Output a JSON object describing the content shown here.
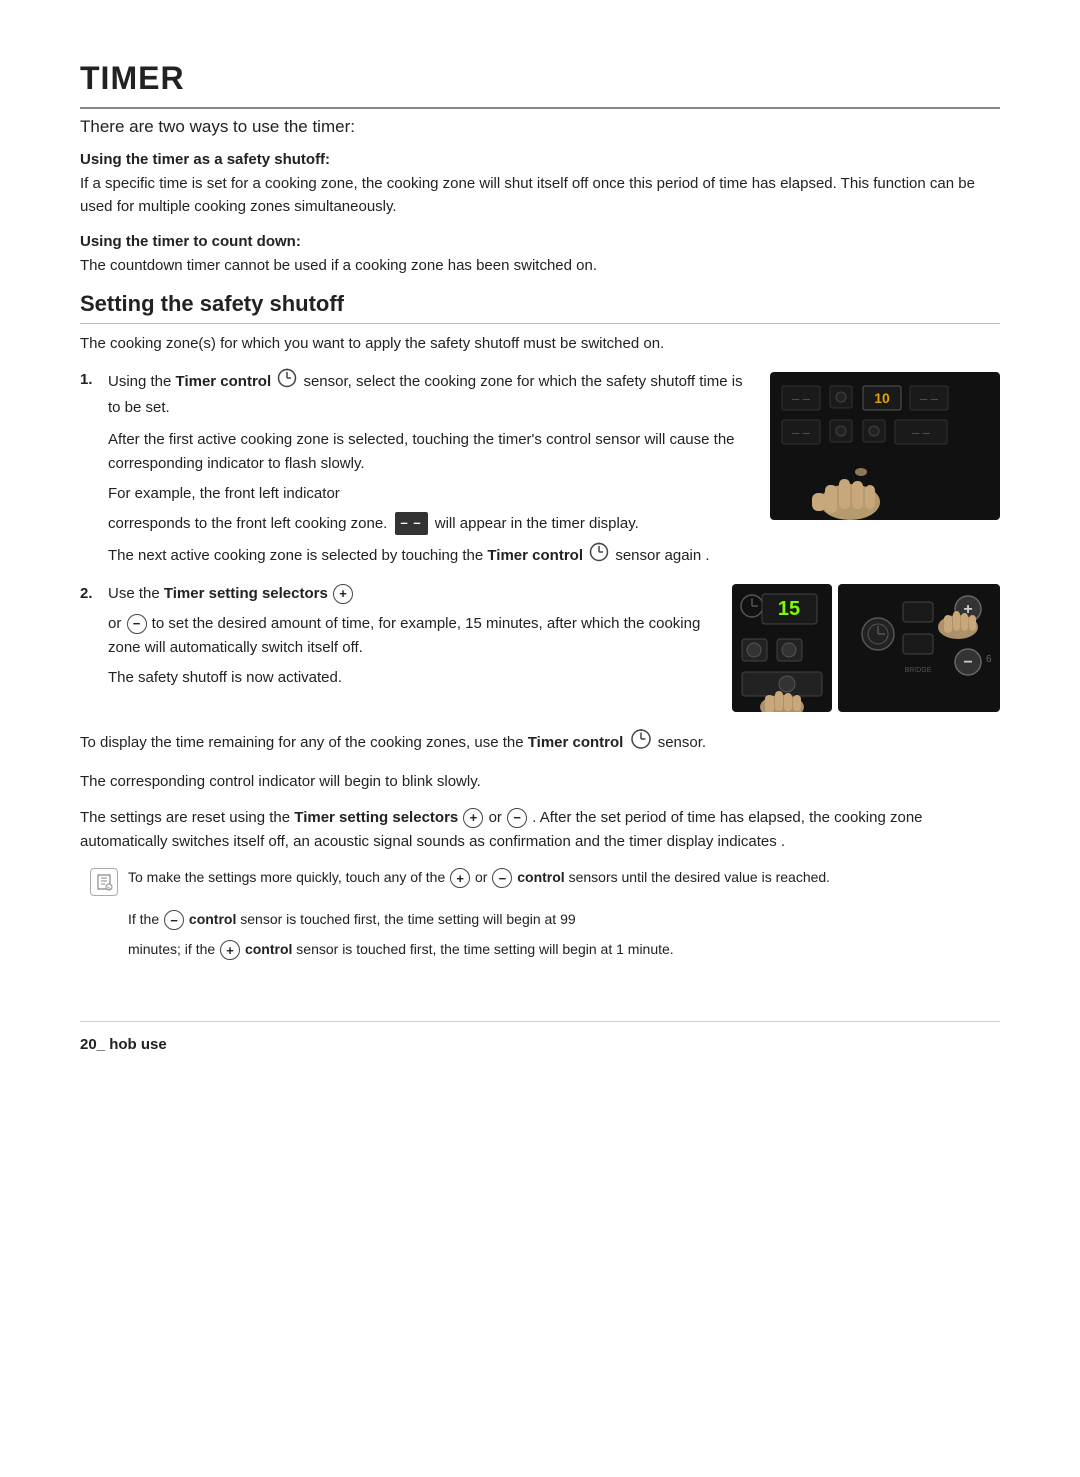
{
  "page": {
    "title": "TIMER",
    "subtitle": "There are two ways to use the timer:",
    "section1": {
      "label": "Using the timer as a safety shutoff:",
      "text": "If a specific time is set for a cooking zone, the cooking zone will shut itself off once this period of time has elapsed. This function can be used for multiple cooking zones simultaneously."
    },
    "section2": {
      "label": "Using the timer to count down:",
      "text": "The countdown timer cannot be used if a cooking zone has been switched on."
    },
    "subheading": "Setting the safety shutoff",
    "intro_para": "The cooking zone(s) for which you want to apply the safety shutoff must be switched on.",
    "step1": {
      "number": "1.",
      "text_a": "Using the ",
      "bold_a": "Timer control",
      "text_b": " sensor, select the cooking zone for which the safety shutoff time is to be set.",
      "text_c": "After the first active cooking zone is selected, touching the timer's control sensor will cause the corresponding indicator to flash slowly.",
      "text_d": "For example, the front left indicator",
      "text_e": "corresponds to the front left cooking zone.",
      "text_f": " will appear in the timer display.",
      "text_g": "The next active cooking zone is selected by touching the ",
      "bold_g": "Timer control",
      "text_h": " sensor again ."
    },
    "step2": {
      "number": "2.",
      "text_a": "Use the ",
      "bold_a": "Timer setting selectors",
      "text_b": " or",
      "text_c": " to set the desired amount of time, for example, 15 minutes, after which the cooking zone will automatically switch itself off.",
      "text_d": "The safety shutoff is now activated."
    },
    "para3": "To display the time remaining for any of the cooking zones, use the ",
    "para3_bold": "Timer control",
    "para3_end": " sensor.",
    "para4": "The corresponding control indicator will begin to blink slowly.",
    "para5_start": "The settings are reset using the ",
    "para5_bold": "Timer setting selectors",
    "para5_end": ". After the set period of time has elapsed, the cooking zone automatically switches itself off, an acoustic signal sounds as confirmation and the timer display indicates .",
    "para5_symbols": "(+) or (−)",
    "note_text": "To make the settings more quickly, touch any of the (+) or (−) control sensors until the desired value is reached.",
    "note2_text": "If the (−) control sensor is touched first, the time setting will begin at 99 minutes; if the (+) control sensor is touched first, the time setting will begin at 1 minute.",
    "footer": "20_ hob use"
  }
}
